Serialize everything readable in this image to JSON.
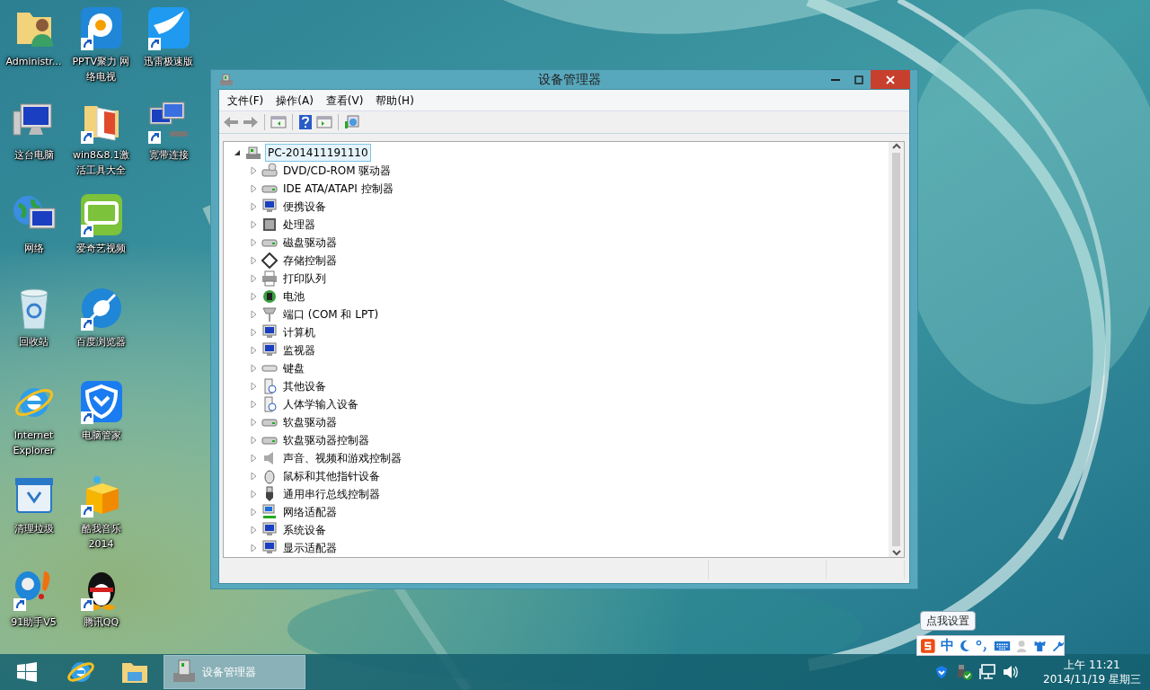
{
  "desktop": {
    "icons": [
      {
        "label": "Administr...",
        "shortcut": false
      },
      {
        "label": "这台电脑",
        "shortcut": false
      },
      {
        "label": "网络",
        "shortcut": false
      },
      {
        "label": "回收站",
        "shortcut": false
      },
      {
        "label": "Internet Explorer",
        "shortcut": false
      },
      {
        "label": "清理垃圾",
        "shortcut": false
      },
      {
        "label": "91助手V5",
        "shortcut": true
      },
      {
        "label": "PPTV聚力 网络电视",
        "shortcut": true
      },
      {
        "label": "win8&8.1激活工具大全",
        "shortcut": true
      },
      {
        "label": "爱奇艺视频",
        "shortcut": true
      },
      {
        "label": "百度浏览器",
        "shortcut": true
      },
      {
        "label": "电脑管家",
        "shortcut": true
      },
      {
        "label": "酷我音乐2014",
        "shortcut": true
      },
      {
        "label": "腾讯QQ",
        "shortcut": true
      },
      {
        "label": "迅雷极速版",
        "shortcut": true
      },
      {
        "label": "宽带连接",
        "shortcut": true
      }
    ]
  },
  "window": {
    "title": "设备管理器",
    "menu": [
      "文件(F)",
      "操作(A)",
      "查看(V)",
      "帮助(H)"
    ],
    "tree": {
      "label": "PC-201411191110",
      "expanded": true,
      "selected": true,
      "children": [
        {
          "label": "DVD/CD-ROM 驱动器",
          "expanded": false
        },
        {
          "label": "IDE ATA/ATAPI 控制器",
          "expanded": false
        },
        {
          "label": "便携设备",
          "expanded": false
        },
        {
          "label": "处理器",
          "expanded": false
        },
        {
          "label": "磁盘驱动器",
          "expanded": false
        },
        {
          "label": "存储控制器",
          "expanded": false
        },
        {
          "label": "打印队列",
          "expanded": false
        },
        {
          "label": "电池",
          "expanded": false
        },
        {
          "label": "端口 (COM 和 LPT)",
          "expanded": false
        },
        {
          "label": "计算机",
          "expanded": false
        },
        {
          "label": "监视器",
          "expanded": false
        },
        {
          "label": "键盘",
          "expanded": false
        },
        {
          "label": "其他设备",
          "expanded": false
        },
        {
          "label": "人体学输入设备",
          "expanded": false
        },
        {
          "label": "软盘驱动器",
          "expanded": false
        },
        {
          "label": "软盘驱动器控制器",
          "expanded": false
        },
        {
          "label": "声音、视频和游戏控制器",
          "expanded": false
        },
        {
          "label": "鼠标和其他指针设备",
          "expanded": false
        },
        {
          "label": "通用串行总线控制器",
          "expanded": false
        },
        {
          "label": "网络适配器",
          "expanded": false
        },
        {
          "label": "系统设备",
          "expanded": false
        },
        {
          "label": "显示适配器",
          "expanded": false
        }
      ]
    }
  },
  "taskbar": {
    "tasks": [
      {
        "label": "设备管理器",
        "active": true
      }
    ],
    "ime": {
      "tooltip": "点我设置",
      "mode": "中"
    },
    "clock": {
      "time": "上午 11:21",
      "date": "2014/11/19 星期三"
    }
  }
}
